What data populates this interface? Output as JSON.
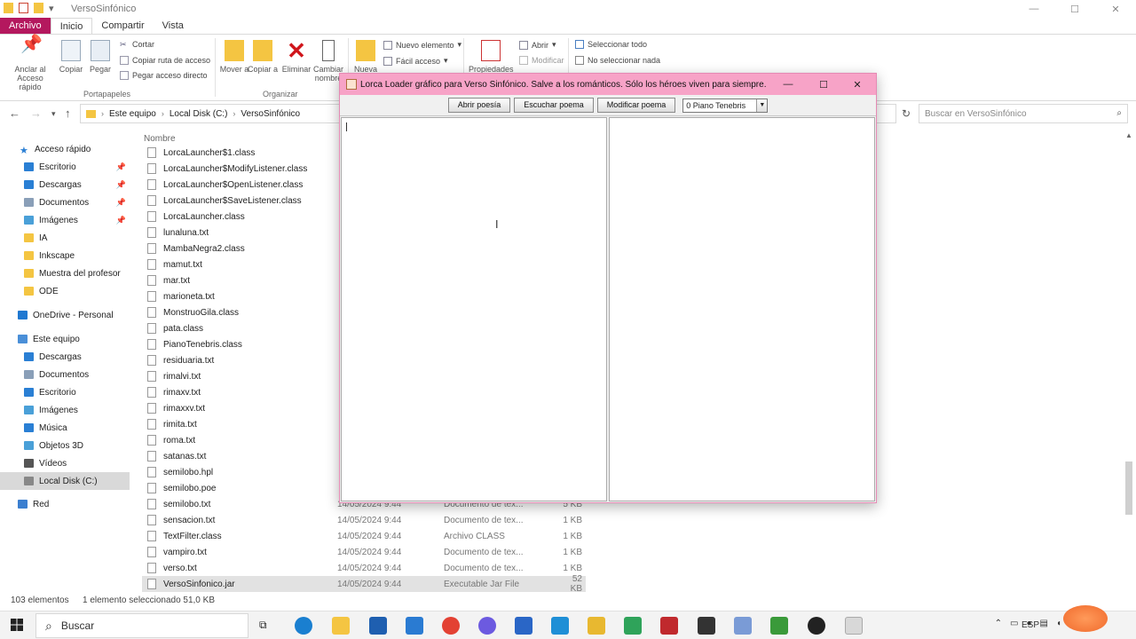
{
  "explorer": {
    "window_title": "VersoSinfónico",
    "ribbon_tabs": [
      "Archivo",
      "Inicio",
      "Compartir",
      "Vista"
    ],
    "ribbon": {
      "pin_label": "Anclar al Acceso rápido",
      "copy_label": "Copiar",
      "paste_label": "Pegar",
      "cut_label": "Cortar",
      "copy_path_label": "Copiar ruta de acceso",
      "paste_shortcut_label": "Pegar acceso directo",
      "portapapeles_label": "Portapapeles",
      "move_label": "Mover a",
      "copy_to_label": "Copiar a",
      "delete_label": "Eliminar",
      "rename_label": "Cambiar nombre",
      "organizar_label": "Organizar",
      "new_folder_label": "Nueva",
      "new_item_label": "Nuevo elemento",
      "easy_access_label": "Fácil acceso",
      "properties_label": "Propiedades",
      "open_label": "Abrir",
      "edit_label": "Modificar",
      "select_all_label": "Seleccionar todo",
      "select_none_label": "No seleccionar nada"
    },
    "address": {
      "crumbs": [
        "Este equipo",
        "Local Disk (C:)",
        "VersoSinfónico"
      ],
      "search_placeholder": "Buscar en VersoSinfónico"
    },
    "nav": {
      "quick_access": "Acceso rápido",
      "qa_items": [
        "Escritorio",
        "Descargas",
        "Documentos",
        "Imágenes",
        "IA",
        "Inkscape",
        "Muestra del profesor",
        "ODE"
      ],
      "onedrive": "OneDrive - Personal",
      "this_pc": "Este equipo",
      "pc_items": [
        "Descargas",
        "Documentos",
        "Escritorio",
        "Imágenes",
        "Música",
        "Objetos 3D",
        "Vídeos",
        "Local Disk (C:)"
      ],
      "network": "Red"
    },
    "column_name": "Nombre",
    "files": [
      {
        "name": "LorcaLauncher$1.class",
        "date": "",
        "type": "",
        "size": ""
      },
      {
        "name": "LorcaLauncher$ModifyListener.class",
        "date": "",
        "type": "",
        "size": ""
      },
      {
        "name": "LorcaLauncher$OpenListener.class",
        "date": "",
        "type": "",
        "size": ""
      },
      {
        "name": "LorcaLauncher$SaveListener.class",
        "date": "",
        "type": "",
        "size": ""
      },
      {
        "name": "LorcaLauncher.class",
        "date": "",
        "type": "",
        "size": ""
      },
      {
        "name": "lunaluna.txt",
        "date": "",
        "type": "",
        "size": ""
      },
      {
        "name": "MambaNegra2.class",
        "date": "",
        "type": "",
        "size": ""
      },
      {
        "name": "mamut.txt",
        "date": "",
        "type": "",
        "size": ""
      },
      {
        "name": "mar.txt",
        "date": "",
        "type": "",
        "size": ""
      },
      {
        "name": "marioneta.txt",
        "date": "",
        "type": "",
        "size": ""
      },
      {
        "name": "MonstruoGila.class",
        "date": "",
        "type": "",
        "size": ""
      },
      {
        "name": "pata.class",
        "date": "",
        "type": "",
        "size": ""
      },
      {
        "name": "PianoTenebris.class",
        "date": "",
        "type": "",
        "size": ""
      },
      {
        "name": "residuaria.txt",
        "date": "",
        "type": "",
        "size": ""
      },
      {
        "name": "rimalvi.txt",
        "date": "",
        "type": "",
        "size": ""
      },
      {
        "name": "rimaxv.txt",
        "date": "",
        "type": "",
        "size": ""
      },
      {
        "name": "rimaxxv.txt",
        "date": "",
        "type": "",
        "size": ""
      },
      {
        "name": "rimita.txt",
        "date": "",
        "type": "",
        "size": ""
      },
      {
        "name": "roma.txt",
        "date": "",
        "type": "",
        "size": ""
      },
      {
        "name": "satanas.txt",
        "date": "",
        "type": "",
        "size": ""
      },
      {
        "name": "semilobo.hpl",
        "date": "",
        "type": "",
        "size": ""
      },
      {
        "name": "semilobo.poe",
        "date": "",
        "type": "",
        "size": ""
      },
      {
        "name": "semilobo.txt",
        "date": "14/05/2024 9:44",
        "type": "Documento de tex...",
        "size": "5 KB"
      },
      {
        "name": "sensacion.txt",
        "date": "14/05/2024 9:44",
        "type": "Documento de tex...",
        "size": "1 KB"
      },
      {
        "name": "TextFilter.class",
        "date": "14/05/2024 9:44",
        "type": "Archivo CLASS",
        "size": "1 KB"
      },
      {
        "name": "vampiro.txt",
        "date": "14/05/2024 9:44",
        "type": "Documento de tex...",
        "size": "1 KB"
      },
      {
        "name": "verso.txt",
        "date": "14/05/2024 9:44",
        "type": "Documento de tex...",
        "size": "1 KB"
      },
      {
        "name": "VersoSinfonico.jar",
        "date": "14/05/2024 9:44",
        "type": "Executable Jar File",
        "size": "52 KB"
      }
    ],
    "status": {
      "count": "103 elementos",
      "selection": "1 elemento seleccionado  51,0 KB"
    }
  },
  "dialog": {
    "title": "Lorca Loader gráfico para Verso Sinfónico. Salve a los románticos. Sólo los héroes viven para siempre.",
    "buttons": [
      "Abrir poesía",
      "Escuchar poema",
      "Modificar poema"
    ],
    "combo_value": "0 Piano Tenebris"
  },
  "taskbar": {
    "search_label": "Buscar",
    "lang": "ESP"
  }
}
